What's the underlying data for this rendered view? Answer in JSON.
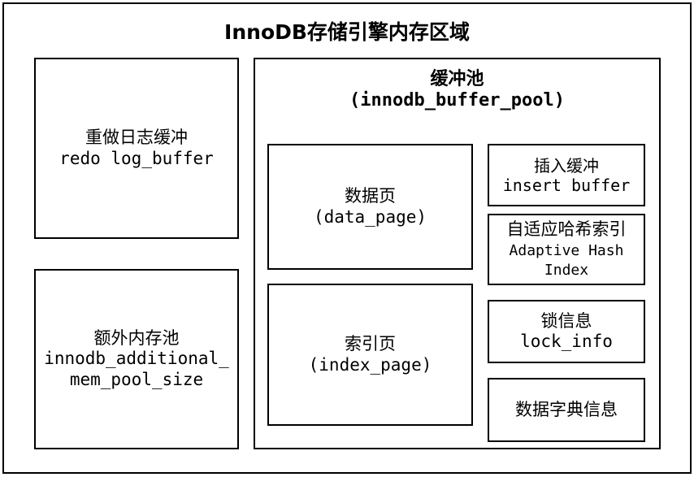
{
  "title": "InnoDB存储引擎内存区域",
  "redo": {
    "label_cn": "重做日志缓冲",
    "label_en": "redo log_buffer"
  },
  "additional": {
    "label_cn": "额外内存池",
    "label_en_1": "innodb_additional_",
    "label_en_2": "mem_pool_size"
  },
  "buffer_pool": {
    "label_cn": "缓冲池",
    "label_en": "(innodb_buffer_pool)",
    "data_page": {
      "label_cn": "数据页",
      "label_en": "(data_page)"
    },
    "index_page": {
      "label_cn": "索引页",
      "label_en": "(index_page)"
    },
    "insert_buffer": {
      "label_cn": "插入缓冲",
      "label_en": "insert buffer"
    },
    "adaptive_hash": {
      "label_cn": "自适应哈希索引",
      "label_en_1": "Adaptive Hash",
      "label_en_2": "Index"
    },
    "lock_info": {
      "label_cn": "锁信息",
      "label_en": "lock_info"
    },
    "data_dictionary": {
      "label_cn": "数据字典信息"
    }
  }
}
